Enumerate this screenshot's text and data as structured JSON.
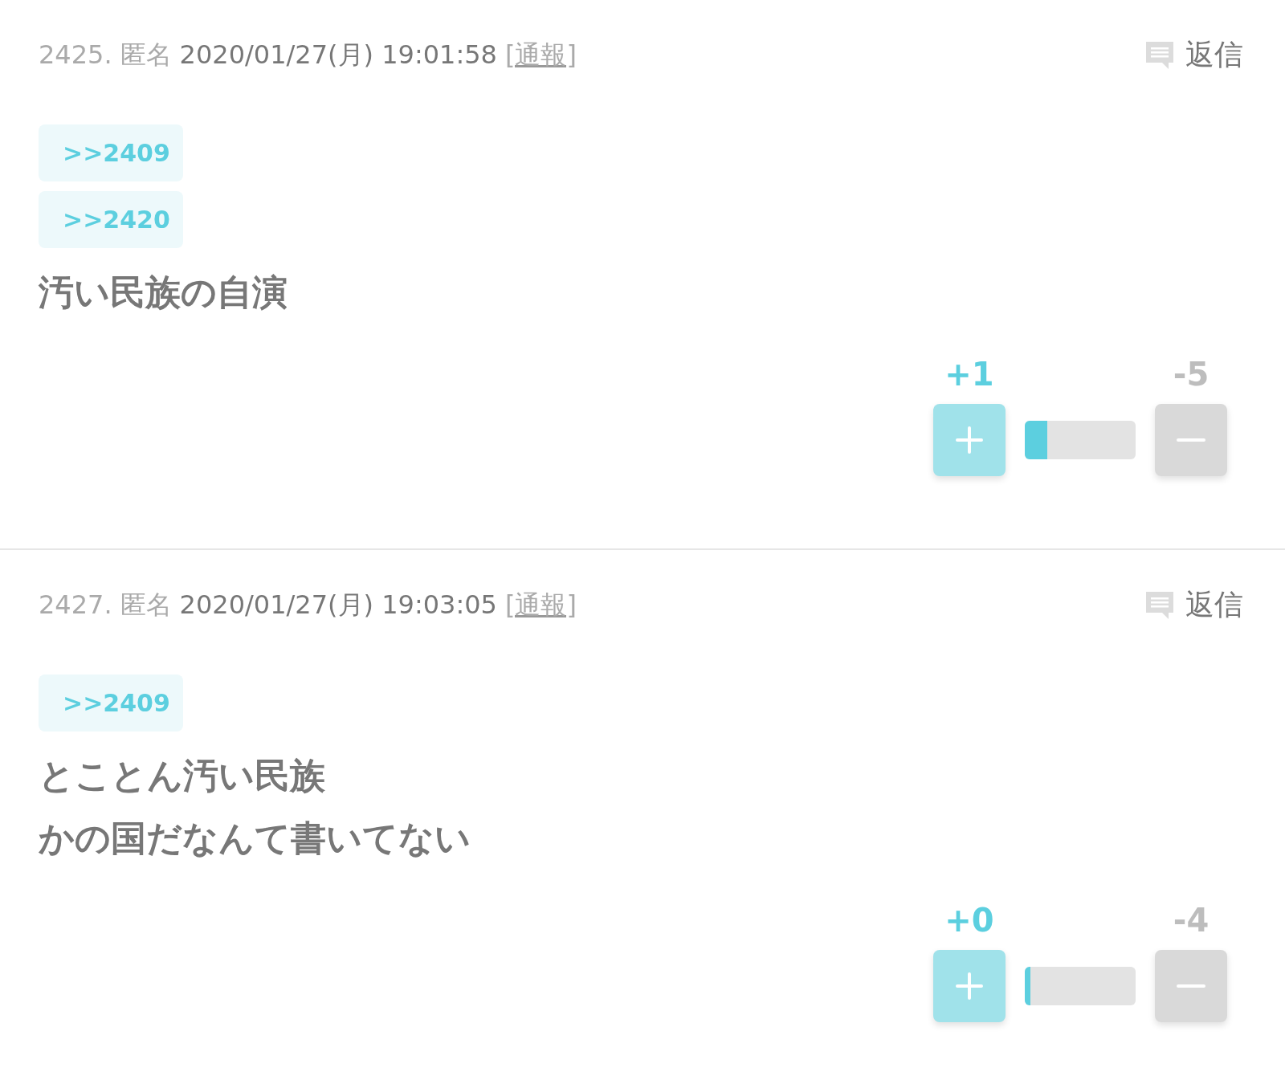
{
  "posts": [
    {
      "number": "2425.",
      "name": "匿名",
      "datetime": "2020/01/27(月) 19:01:58",
      "report": "[通報]",
      "reply": "返信",
      "anchors": [
        ">>2409",
        ">>2420"
      ],
      "body": [
        "汚い民族の自演"
      ],
      "plus": "+1",
      "minus": "-5",
      "level": 0.2
    },
    {
      "number": "2427.",
      "name": "匿名",
      "datetime": "2020/01/27(月) 19:03:05",
      "report": "[通報]",
      "reply": "返信",
      "anchors": [
        ">>2409"
      ],
      "body": [
        "とことん汚い民族",
        "かの国だなんて書いてない"
      ],
      "plus": "+0",
      "minus": "-4",
      "level": 0.05
    }
  ]
}
